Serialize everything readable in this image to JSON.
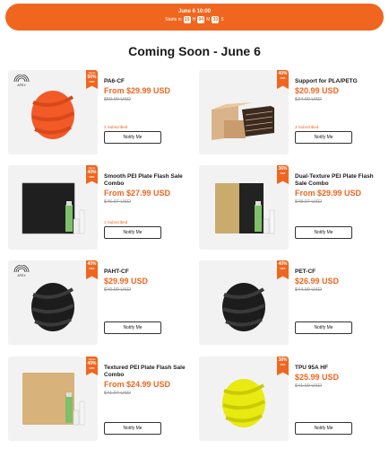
{
  "banner": {
    "date": "June 6 10:00",
    "starts_label": "Starts in",
    "days": "15",
    "days_unit": "H",
    "hours": "04",
    "hours_unit": "M",
    "minutes": "33",
    "minutes_unit": "S"
  },
  "section_title": "Coming Soon - June 6",
  "brand_text": "APEX",
  "products": [
    {
      "name": "PA6-CF",
      "price": "From $29.99 USD",
      "orig": "$59.99 USD",
      "subscribed": "2 Subscribed",
      "badge_top": "Up to",
      "badge_pct": "50%",
      "badge_off": "OFF",
      "notify": "Notify Me"
    },
    {
      "name": "Support for PLA/PETG",
      "price": "$20.99 USD",
      "orig": "$34.99 USD",
      "subscribed": "3 Subscribed",
      "badge_top": "",
      "badge_pct": "40%",
      "badge_off": "OFF",
      "notify": "Notify Me"
    },
    {
      "name": "Smooth PEI Plate Flash Sale Combo",
      "price": "From $27.99 USD",
      "orig": "$46.97 USD",
      "subscribed": "1 Subscribed",
      "badge_top": "Up to",
      "badge_pct": "40%",
      "badge_off": "OFF",
      "notify": "Notify Me"
    },
    {
      "name": "Dual-Texture PEI Plate Flash Sale Combo",
      "price": "From $29.99 USD",
      "orig": "$48.97 USD",
      "subscribed": "",
      "badge_top": "",
      "badge_pct": "36%",
      "badge_off": "OFF",
      "notify": "Notify Me"
    },
    {
      "name": "PAHT-CF",
      "price": "$29.99 USD",
      "orig": "$49.99 USD",
      "subscribed": "",
      "badge_top": "",
      "badge_pct": "40%",
      "badge_off": "OFF",
      "notify": "Notify Me"
    },
    {
      "name": "PET-CF",
      "price": "$26.99 USD",
      "orig": "$44.99 USD",
      "subscribed": "",
      "badge_top": "",
      "badge_pct": "40%",
      "badge_off": "OFF",
      "notify": "Notify Me"
    },
    {
      "name": "Textured PEI Plate Flash Sale Combo",
      "price": "From $24.99 USD",
      "orig": "$41.97 USD",
      "subscribed": "",
      "badge_top": "Up to",
      "badge_pct": "40%",
      "badge_off": "OFF",
      "notify": "Notify Me"
    },
    {
      "name": "TPU 95A HF",
      "price": "$25.99 USD",
      "orig": "$41.99 USD",
      "subscribed": "",
      "badge_top": "",
      "badge_pct": "38%",
      "badge_off": "OFF",
      "notify": "Notify Me"
    }
  ],
  "colors": {
    "accent": "#f0661f",
    "card_bg": "#f2f2f2"
  }
}
